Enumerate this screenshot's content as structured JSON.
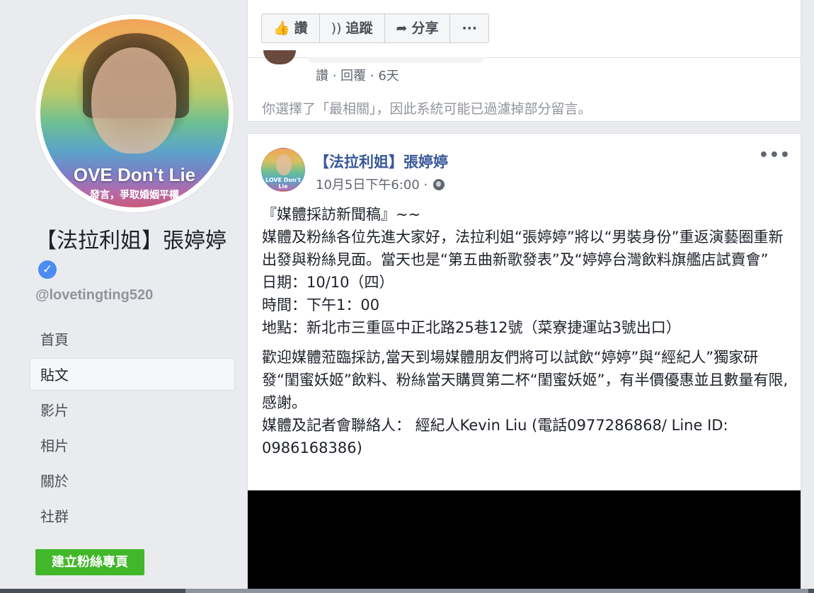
{
  "profile": {
    "avatar_banner": "OVE Don't Lie",
    "avatar_banner_sub": "發言，爭取婚姻平權",
    "name": "【法拉利姐】張婷婷",
    "verified_mark": "✓",
    "handle": "@lovetingting520"
  },
  "nav": {
    "items": [
      {
        "label": "首頁"
      },
      {
        "label": "貼文"
      },
      {
        "label": "影片"
      },
      {
        "label": "相片"
      },
      {
        "label": "關於"
      },
      {
        "label": "社群"
      }
    ],
    "active": "貼文"
  },
  "create_page_button": "建立粉絲專頁",
  "action_bar": {
    "like": {
      "icon": "thumbs-up-icon",
      "label": "讚"
    },
    "follow": {
      "icon": "rss-icon",
      "label": "追蹤"
    },
    "share": {
      "icon": "share-arrow-icon",
      "label": "分享"
    },
    "more": "···"
  },
  "comment": {
    "meta": "讚 · 回覆 · 6天"
  },
  "filter_note": "你選擇了「最相關」，因此系統可能已過濾掉部分留言。",
  "post": {
    "avatar_text": "LOVE Don't Lie",
    "author": "【法拉利姐】張婷婷",
    "time": "10月5日下午6:00 · ",
    "privacy_icon": "globe-icon",
    "more": "•••",
    "lines": [
      "『媒體採訪新聞稿』~~",
      "媒體及粉絲各位先進大家好，法拉利姐“張婷婷”將以“男裝身份”重返演藝圈重新出發與粉絲見面。當天也是“第五曲新歌發表”及“婷婷台灣飲料旗艦店試賣會”",
      "日期：10/10（四）",
      "時間：下午1：00",
      "地點：新北市三重區中正北路25巷12號（菜寮捷運站3號出口）"
    ],
    "lines2": [
      "歡迎媒體蒞臨採訪,當天到場媒體朋友們將可以試飲“婷婷”與“經紀人”獨家研發“閨蜜妖姬”飲料、粉絲當天購買第二杯“閨蜜妖姬”，有半價優惠並且數量有限,感謝。",
      "媒體及記者會聯絡人： 經紀人Kevin Liu (電話0977286868/ Line ID: 0986168386)"
    ]
  },
  "colors": {
    "link": "#385898",
    "green": "#42b72a",
    "verified": "#4b8cf5",
    "background": "#e9ebee"
  }
}
